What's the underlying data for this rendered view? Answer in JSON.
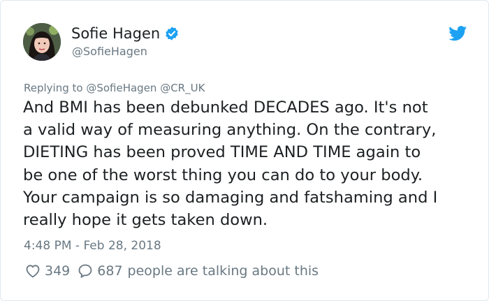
{
  "author": {
    "display_name": "Sofie Hagen",
    "handle": "@SofieHagen",
    "verified": true,
    "avatar_icon": "profile-photo"
  },
  "reply_to": "Replying to @SofieHagen @CR_UK",
  "tweet": {
    "text": "And BMI has been debunked DECADES ago. It's not\na valid way of measuring anything. On the contrary,\nDIETING has been proved TIME AND TIME again to\nbe one of the worst thing you can do to your body.\nYour campaign is so damaging and fatshaming and I\nreally hope it gets taken down."
  },
  "timestamp": "4:48 PM - Feb 28, 2018",
  "engagement": {
    "likes": "349",
    "talking_count": "687",
    "talking_text": "people are talking about this"
  },
  "icons": {
    "verified": "verified-badge-icon",
    "brand": "twitter-bird-icon",
    "like": "heart-icon",
    "reply": "speech-bubble-icon"
  },
  "colors": {
    "brand_blue": "#1da1f2",
    "text_primary": "#1c2022",
    "text_secondary": "#697882",
    "border": "#e1e8ed"
  }
}
